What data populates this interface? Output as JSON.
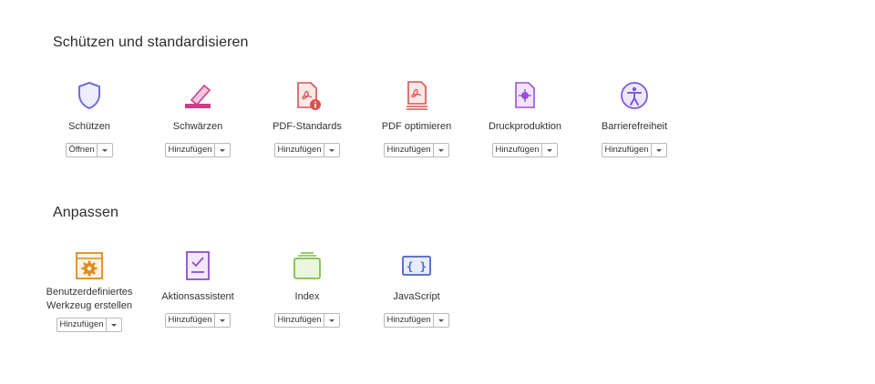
{
  "sections": [
    {
      "title": "Schützen und standardisieren",
      "tools": [
        {
          "label": "Schützen",
          "icon": "shield-icon",
          "button": "Öffnen"
        },
        {
          "label": "Schwärzen",
          "icon": "redact-marker-icon",
          "button": "Hinzufügen"
        },
        {
          "label": "PDF-Standards",
          "icon": "pdf-standards-icon",
          "button": "Hinzufügen"
        },
        {
          "label": "PDF optimieren",
          "icon": "pdf-optimize-icon",
          "button": "Hinzufügen"
        },
        {
          "label": "Druckproduktion",
          "icon": "print-production-icon",
          "button": "Hinzufügen"
        },
        {
          "label": "Barrierefreiheit",
          "icon": "accessibility-icon",
          "button": "Hinzufügen"
        }
      ]
    },
    {
      "title": "Anpassen",
      "tools": [
        {
          "label_line1": "Benutzerdefiniertes",
          "label_line2": "Werkzeug erstellen",
          "icon": "custom-tool-gear-icon",
          "button": "Hinzufügen"
        },
        {
          "label": "Aktionsassistent",
          "icon": "action-wizard-icon",
          "button": "Hinzufügen"
        },
        {
          "label": "Index",
          "icon": "index-icon",
          "button": "Hinzufügen"
        },
        {
          "label": "JavaScript",
          "icon": "javascript-icon",
          "button": "Hinzufügen"
        }
      ]
    }
  ],
  "colors": {
    "shield": "#6f6fd6",
    "redact": "#cc3e8a",
    "pdf_red": "#d9534f",
    "print": "#9b4fd6",
    "accessibility": "#7c5bd6",
    "custom_tool": "#e08a1e",
    "action": "#8e4fc6",
    "index": "#7cc04a",
    "javascript": "#4a63c9"
  }
}
